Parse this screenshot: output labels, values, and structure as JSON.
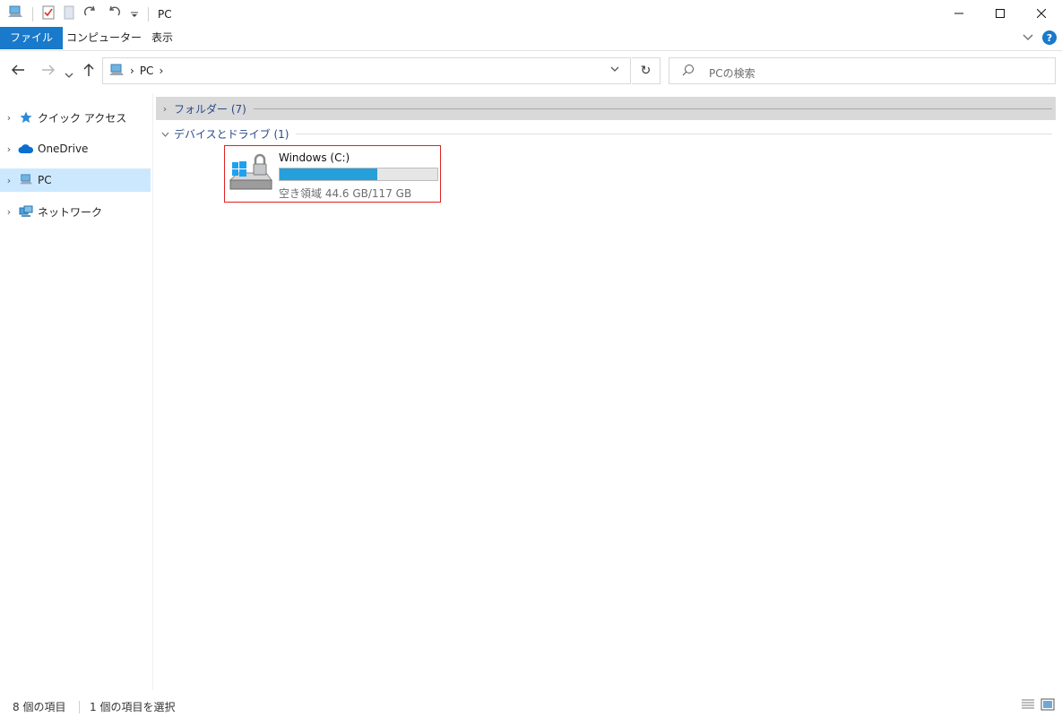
{
  "window": {
    "title": "PC",
    "controls": [
      "minimize",
      "maximize",
      "close"
    ]
  },
  "ribbon": {
    "tabs": [
      {
        "label": "ファイル",
        "active": true
      },
      {
        "label": "コンピューター"
      },
      {
        "label": "表示"
      }
    ]
  },
  "nav": {
    "breadcrumb": [
      "PC"
    ],
    "search_placeholder": "PCの検索"
  },
  "sidebar": {
    "items": [
      {
        "label": "クイック アクセス",
        "icon": "star-icon"
      },
      {
        "label": "OneDrive",
        "icon": "cloud-icon"
      },
      {
        "label": "PC",
        "icon": "computer-icon",
        "selected": true
      },
      {
        "label": "ネットワーク",
        "icon": "network-icon"
      }
    ]
  },
  "content": {
    "groups": [
      {
        "label": "フォルダー (7)",
        "expanded": false
      },
      {
        "label": "デバイスとドライブ (1)",
        "expanded": true
      }
    ],
    "drive": {
      "name": "Windows (C:)",
      "free_text": "空き領域 44.6 GB/117 GB",
      "used_fraction": 0.62
    }
  },
  "statusbar": {
    "item_count": "8 個の項目",
    "selected": "1 個の項目を選択"
  },
  "colors": {
    "accent": "#1979ca",
    "selection": "#cce8ff",
    "drive_bar": "#26a0da",
    "highlight_border": "#e02020"
  }
}
